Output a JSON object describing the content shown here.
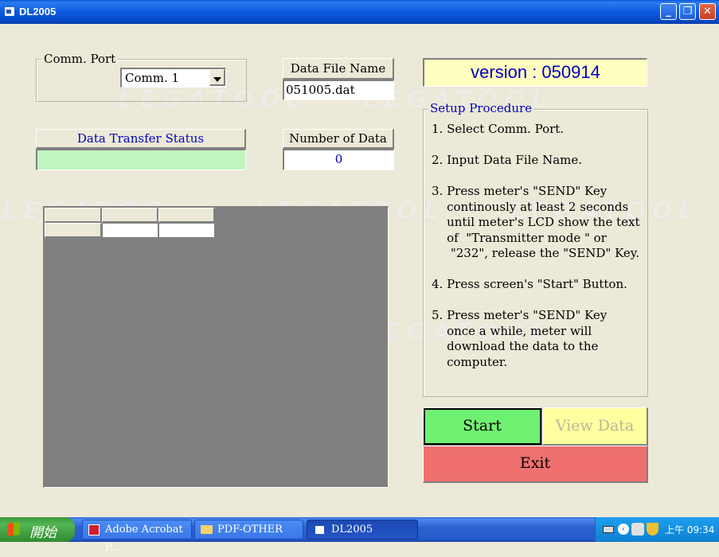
{
  "window": {
    "title": "DL2005",
    "buttons": {
      "minimize": "_",
      "restore": "❐",
      "close": "✕"
    }
  },
  "comm_port": {
    "group_label": "Comm. Port",
    "selected": "Comm. 1"
  },
  "data_file": {
    "header": "Data File Name",
    "value": "051005.dat"
  },
  "version": {
    "text": "version : 050914"
  },
  "transfer_status": {
    "header": "Data Transfer Status",
    "value": ""
  },
  "number_of_data": {
    "header": "Number of  Data",
    "value": "0"
  },
  "setup": {
    "title": "Setup Procedure",
    "steps": [
      "1. Select Comm. Port.",
      "2. Input Data File Name.",
      "3. Press meter's \"SEND\" Key\n    continously at least 2 seconds\n    until meter's LCD show the text\n    of  \"Transmitter mode \" or\n     \"232\", release the \"SEND\" Key.",
      "4. Press screen's \"Start\" Button.",
      "5. Press meter's \"SEND\" Key\n    once a while, meter will\n    download the data to the\n    computer."
    ]
  },
  "buttons": {
    "start": "Start",
    "view_data": "View Data",
    "exit": "Exit"
  },
  "grid": {
    "rows": [
      [
        "",
        "",
        ""
      ],
      [
        "",
        "",
        ""
      ]
    ]
  },
  "watermark": "LEGATOOL",
  "colors": {
    "status_green": "#c0f5c0",
    "version_bg": "#ffffc0",
    "start_green": "#70f070",
    "view_yellow": "#ffffa0",
    "exit_red": "#f07070",
    "setup_title_blue": "#0000c0"
  },
  "taskbar": {
    "start_label": "開始",
    "tasks": [
      {
        "label": "Adobe Acrobat P...",
        "icon": "acrobat-icon"
      },
      {
        "label": "PDF-OTHER",
        "icon": "folder-icon"
      },
      {
        "label": "DL2005",
        "icon": "app-icon"
      }
    ],
    "clock": "上午 09:34"
  }
}
